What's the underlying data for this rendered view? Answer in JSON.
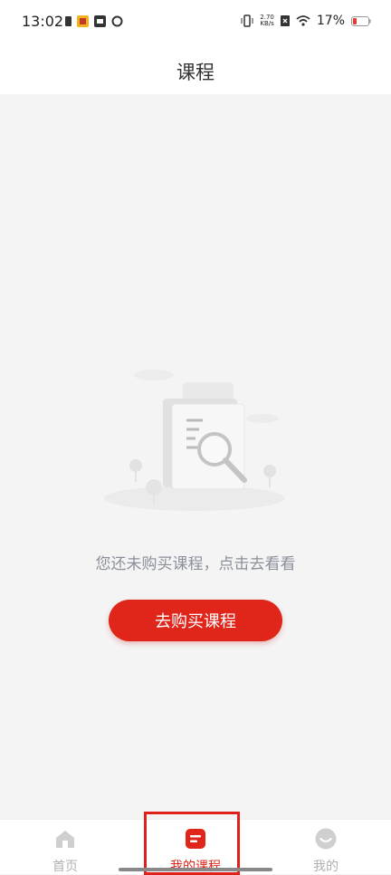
{
  "status_bar": {
    "time": "13:02",
    "net_speed_value": "2.70",
    "net_speed_unit": "KB/s",
    "battery_percent": "17%"
  },
  "header": {
    "title": "课程"
  },
  "empty_state": {
    "message": "您还未购买课程，点击去看看",
    "button_label": "去购买课程"
  },
  "tabbar": {
    "items": [
      {
        "label": "首页",
        "icon": "home-icon",
        "active": false
      },
      {
        "label": "我的课程",
        "icon": "course-icon",
        "active": true
      },
      {
        "label": "我的",
        "icon": "profile-icon",
        "active": false
      }
    ]
  },
  "colors": {
    "accent": "#e0251a",
    "inactive": "#b0b0b0",
    "background": "#f4f4f4"
  }
}
